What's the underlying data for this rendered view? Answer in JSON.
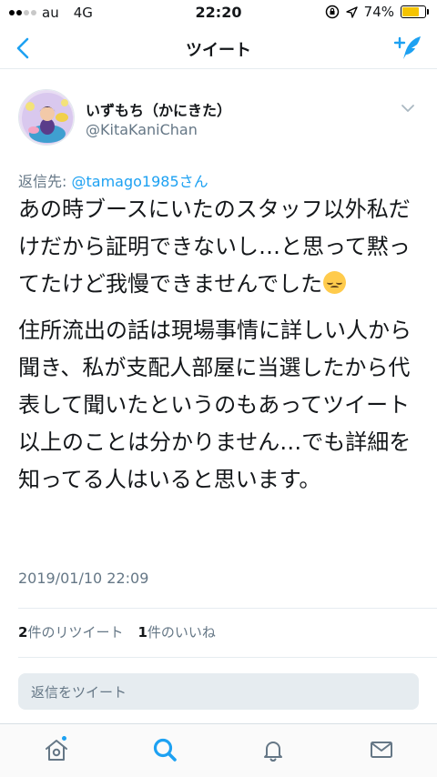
{
  "status_bar": {
    "carrier": "au",
    "network": "4G",
    "time": "22:20",
    "battery_percent": "74%",
    "battery_level": 0.74,
    "icons": [
      "orientation-lock-icon",
      "location-arrow-icon",
      "battery-icon"
    ]
  },
  "nav": {
    "title": "ツイート",
    "back_icon": "chevron-left-icon",
    "compose_icon": "compose-tweet-icon"
  },
  "tweet": {
    "author": {
      "display_name": "いずもち（かにきた）",
      "handle": "@KitaKaniChan"
    },
    "reply_to": {
      "prefix": "返信先: ",
      "mention": "@tamago1985さん"
    },
    "paragraph_1": "あの時ブースにいたのスタッフ以外私だけだから証明できないし…と思って黙ってたけど我慢できませんでした",
    "paragraph_1_emoji": "disappointed-face-emoji",
    "paragraph_2": "住所流出の話は現場事情に詳しい人から聞き、私が支配人部屋に当選したから代表して聞いたというのもあってツイート以上のことは分かりません…でも詳細を知ってる人はいると思います。",
    "timestamp": "2019/01/10 22:09"
  },
  "stats": {
    "retweet_count": "2",
    "retweet_label": "件のリツイート",
    "like_count": "1",
    "like_label": "件のいいね"
  },
  "reply_box": {
    "placeholder": "返信をツイート"
  },
  "tab_bar": {
    "items": [
      {
        "name": "home",
        "icon": "home-icon",
        "active": false,
        "has_dot": true
      },
      {
        "name": "search",
        "icon": "search-icon",
        "active": true,
        "has_dot": false
      },
      {
        "name": "notifications",
        "icon": "bell-icon",
        "active": false,
        "has_dot": false
      },
      {
        "name": "messages",
        "icon": "mail-icon",
        "active": false,
        "has_dot": false
      }
    ]
  },
  "colors": {
    "accent": "#1da1f2",
    "text": "#14171a",
    "secondary": "#657786",
    "divider": "#e6ecf0"
  }
}
